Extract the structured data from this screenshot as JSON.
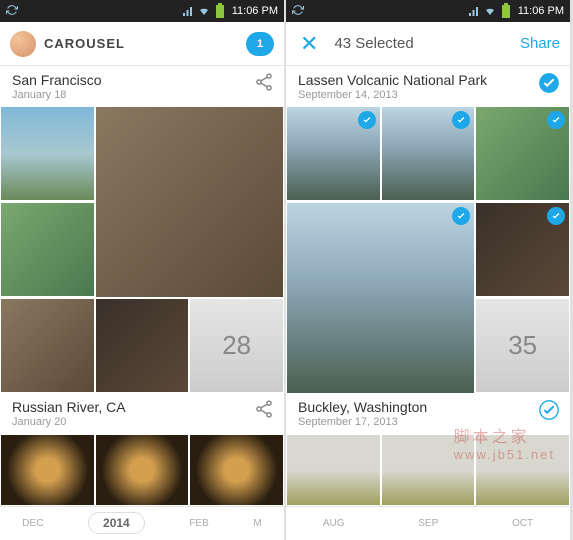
{
  "status": {
    "time": "11:06 PM"
  },
  "left": {
    "app_name": "CAROUSEL",
    "messages_badge": "1",
    "sections": [
      {
        "location": "San Francisco",
        "date": "January 18"
      },
      {
        "location": "Russian River, CA",
        "date": "January 20"
      }
    ],
    "more_count": "28",
    "timeline": {
      "t0": "DEC",
      "year": "2014",
      "t1": "FEB",
      "t2": "M"
    }
  },
  "right": {
    "selected_count": "43 Selected",
    "share_label": "Share",
    "sections": [
      {
        "location": "Lassen Volcanic National Park",
        "date": "September 14, 2013"
      },
      {
        "location": "Buckley, Washington",
        "date": "September 17, 2013"
      }
    ],
    "more_count": "35",
    "timeline": {
      "t0": "AUG",
      "t1": "SEP",
      "t2": "OCT"
    }
  },
  "watermark": {
    "cn": "脚本之家",
    "url": "www.jb51.net"
  }
}
